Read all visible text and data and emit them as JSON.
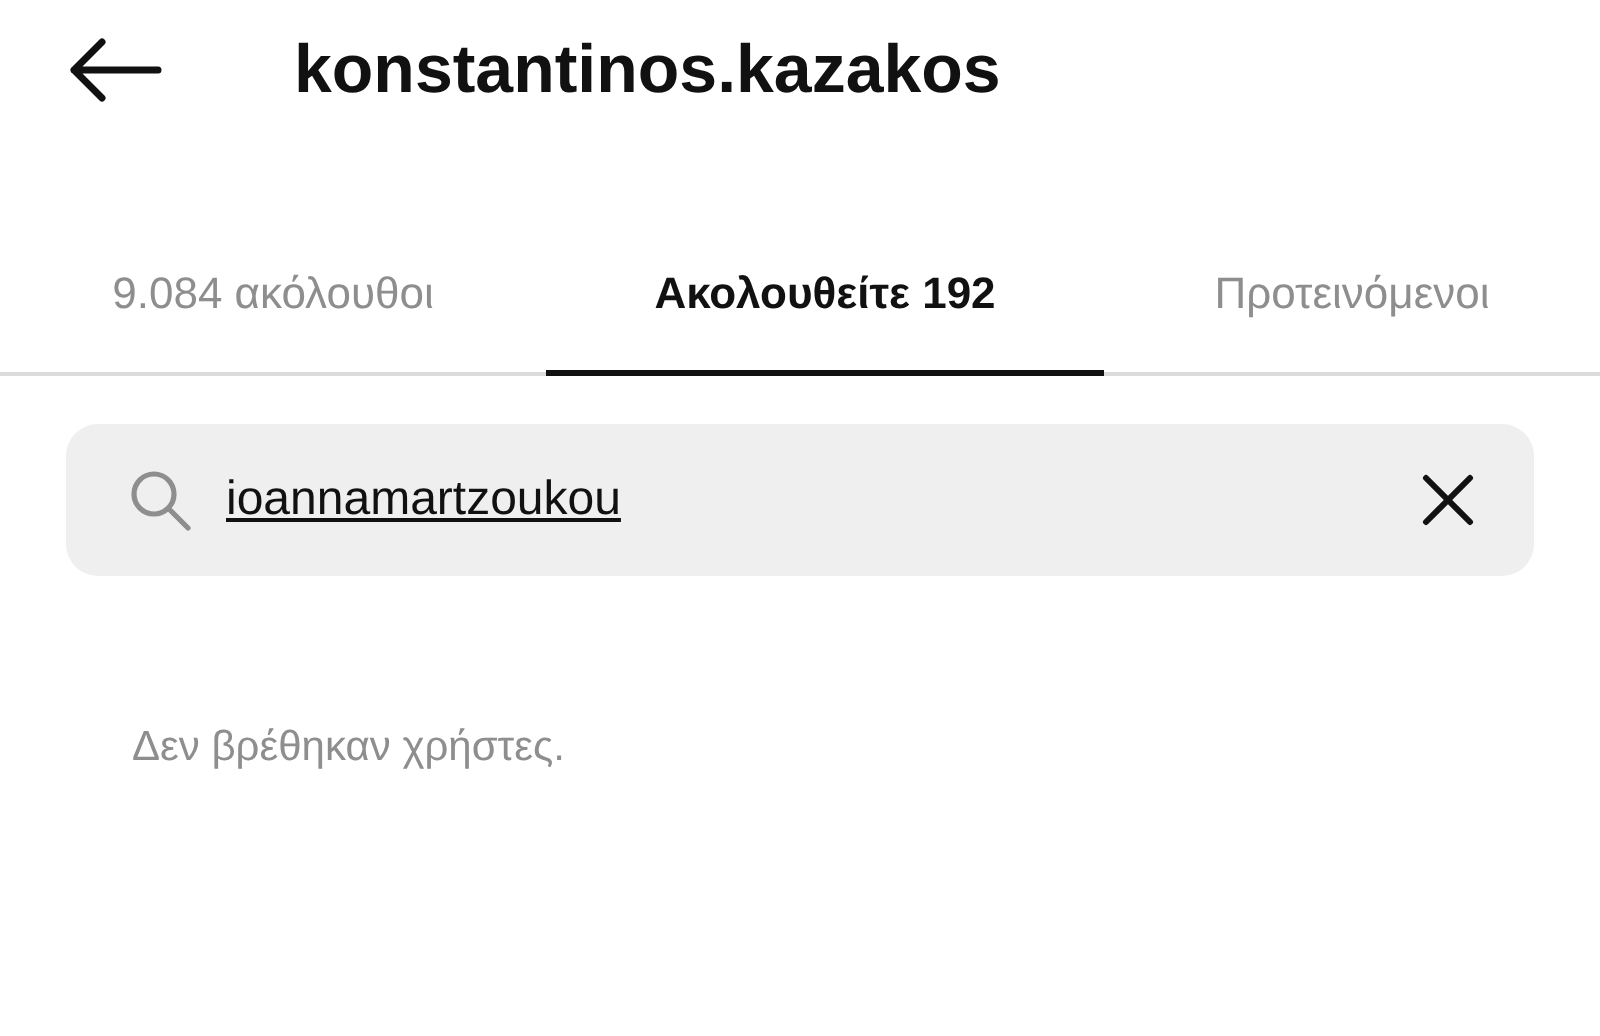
{
  "header": {
    "title": "konstantinos.kazakos"
  },
  "tabs": [
    {
      "label": "9.084 ακόλουθοι",
      "selected": false
    },
    {
      "label": "Ακολουθείτε 192",
      "selected": true
    },
    {
      "label": "Προτεινόμενοι",
      "selected": false
    }
  ],
  "search": {
    "value": "ioannamartzoukou"
  },
  "empty_message": "Δεν βρέθηκαν χρήστες."
}
